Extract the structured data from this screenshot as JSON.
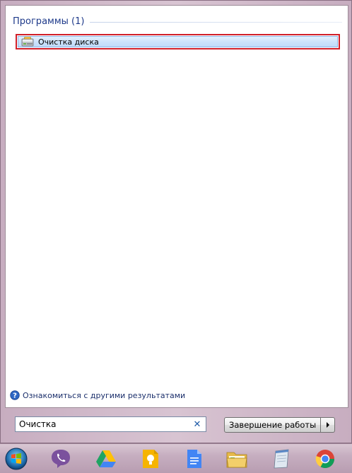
{
  "results": {
    "group_title": "Программы (1)",
    "items": [
      {
        "label": "Очистка диска",
        "icon": "disk-cleanup-icon"
      }
    ],
    "see_more": "Ознакомиться с другими результатами"
  },
  "search": {
    "value": "Очистка"
  },
  "shutdown": {
    "label": "Завершение работы"
  },
  "taskbar": {
    "items": [
      {
        "name": "start-orb",
        "icon": "windows-start-icon"
      },
      {
        "name": "viber",
        "icon": "viber-icon"
      },
      {
        "name": "google-drive",
        "icon": "google-drive-icon"
      },
      {
        "name": "google-keep",
        "icon": "google-keep-icon"
      },
      {
        "name": "google-docs",
        "icon": "google-docs-icon"
      },
      {
        "name": "explorer",
        "icon": "folder-icon"
      },
      {
        "name": "notepad",
        "icon": "notepad-icon"
      },
      {
        "name": "chrome",
        "icon": "chrome-icon"
      }
    ]
  },
  "colors": {
    "highlight_border": "#d1202a",
    "group_title": "#1e3a8a",
    "link": "#1b2f6b"
  }
}
